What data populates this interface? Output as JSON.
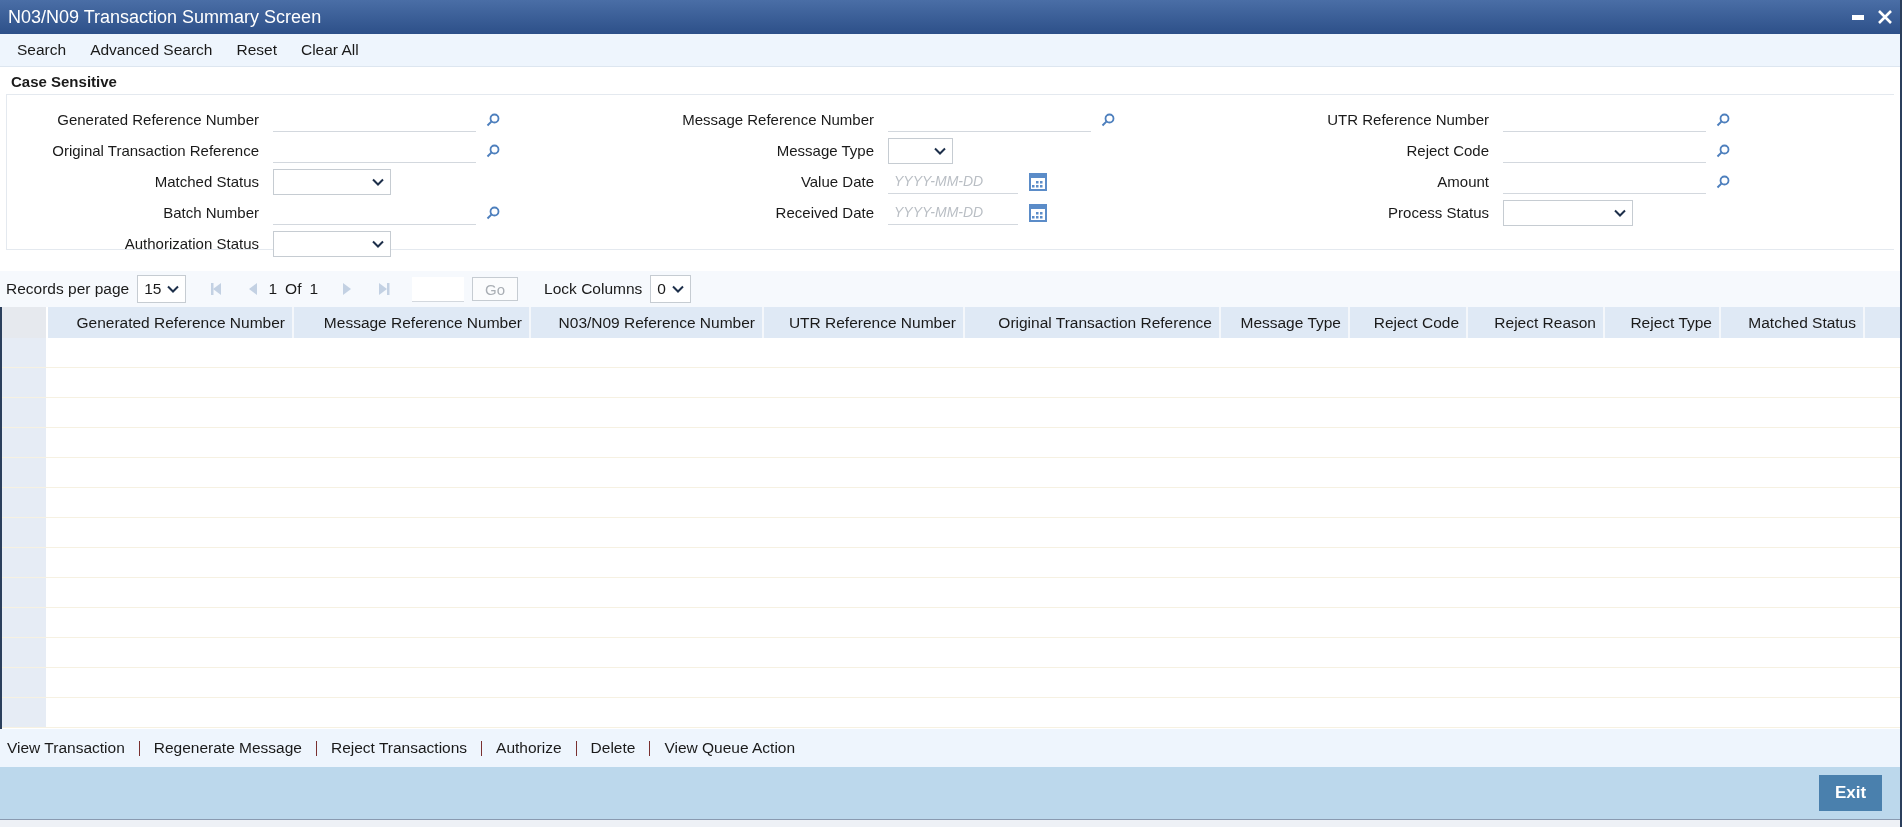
{
  "window": {
    "title": "N03/N09 Transaction Summary Screen"
  },
  "toolbar": [
    "Search",
    "Advanced Search",
    "Reset",
    "Clear All"
  ],
  "criteria": {
    "legend": "Case Sensitive",
    "columns": [
      [
        {
          "kind": "lookup",
          "label": "Generated Reference Number"
        },
        {
          "kind": "lookup",
          "label": "Original Transaction Reference"
        },
        {
          "kind": "select",
          "label": "Matched Status"
        },
        {
          "kind": "lookup",
          "label": "Batch Number"
        },
        {
          "kind": "select",
          "label": "Authorization Status"
        }
      ],
      [
        {
          "kind": "lookup",
          "label": "Message Reference Number"
        },
        {
          "kind": "select",
          "label": "Message Type"
        },
        {
          "kind": "date",
          "label": "Value Date",
          "placeholder": "YYYY-MM-DD"
        },
        {
          "kind": "date",
          "label": "Received Date",
          "placeholder": "YYYY-MM-DD"
        }
      ],
      [
        {
          "kind": "lookup",
          "label": "UTR Reference Number"
        },
        {
          "kind": "lookup",
          "label": "Reject Code"
        },
        {
          "kind": "lookup",
          "label": "Amount"
        },
        {
          "kind": "select",
          "label": "Process Status"
        }
      ]
    ]
  },
  "pagination": {
    "label": "Records per page",
    "page_size": "15",
    "page": "1",
    "of": "Of",
    "total": "1",
    "go": "Go",
    "go_disabled": true,
    "lock_label": "Lock Columns",
    "lock_value": "0"
  },
  "table": {
    "columns": [
      "Generated Reference Number",
      "Message Reference Number",
      "N03/N09 Reference Number",
      "UTR Reference Number",
      "Original Transaction Reference",
      "Message Type",
      "Reject Code",
      "Reject Reason",
      "Reject Type",
      "Matched Status"
    ]
  },
  "actions": [
    "View Transaction",
    "Regenerate Message",
    "Reject Transactions",
    "Authorize",
    "Delete",
    "View Queue Action"
  ],
  "footer": {
    "button": "Exit"
  }
}
